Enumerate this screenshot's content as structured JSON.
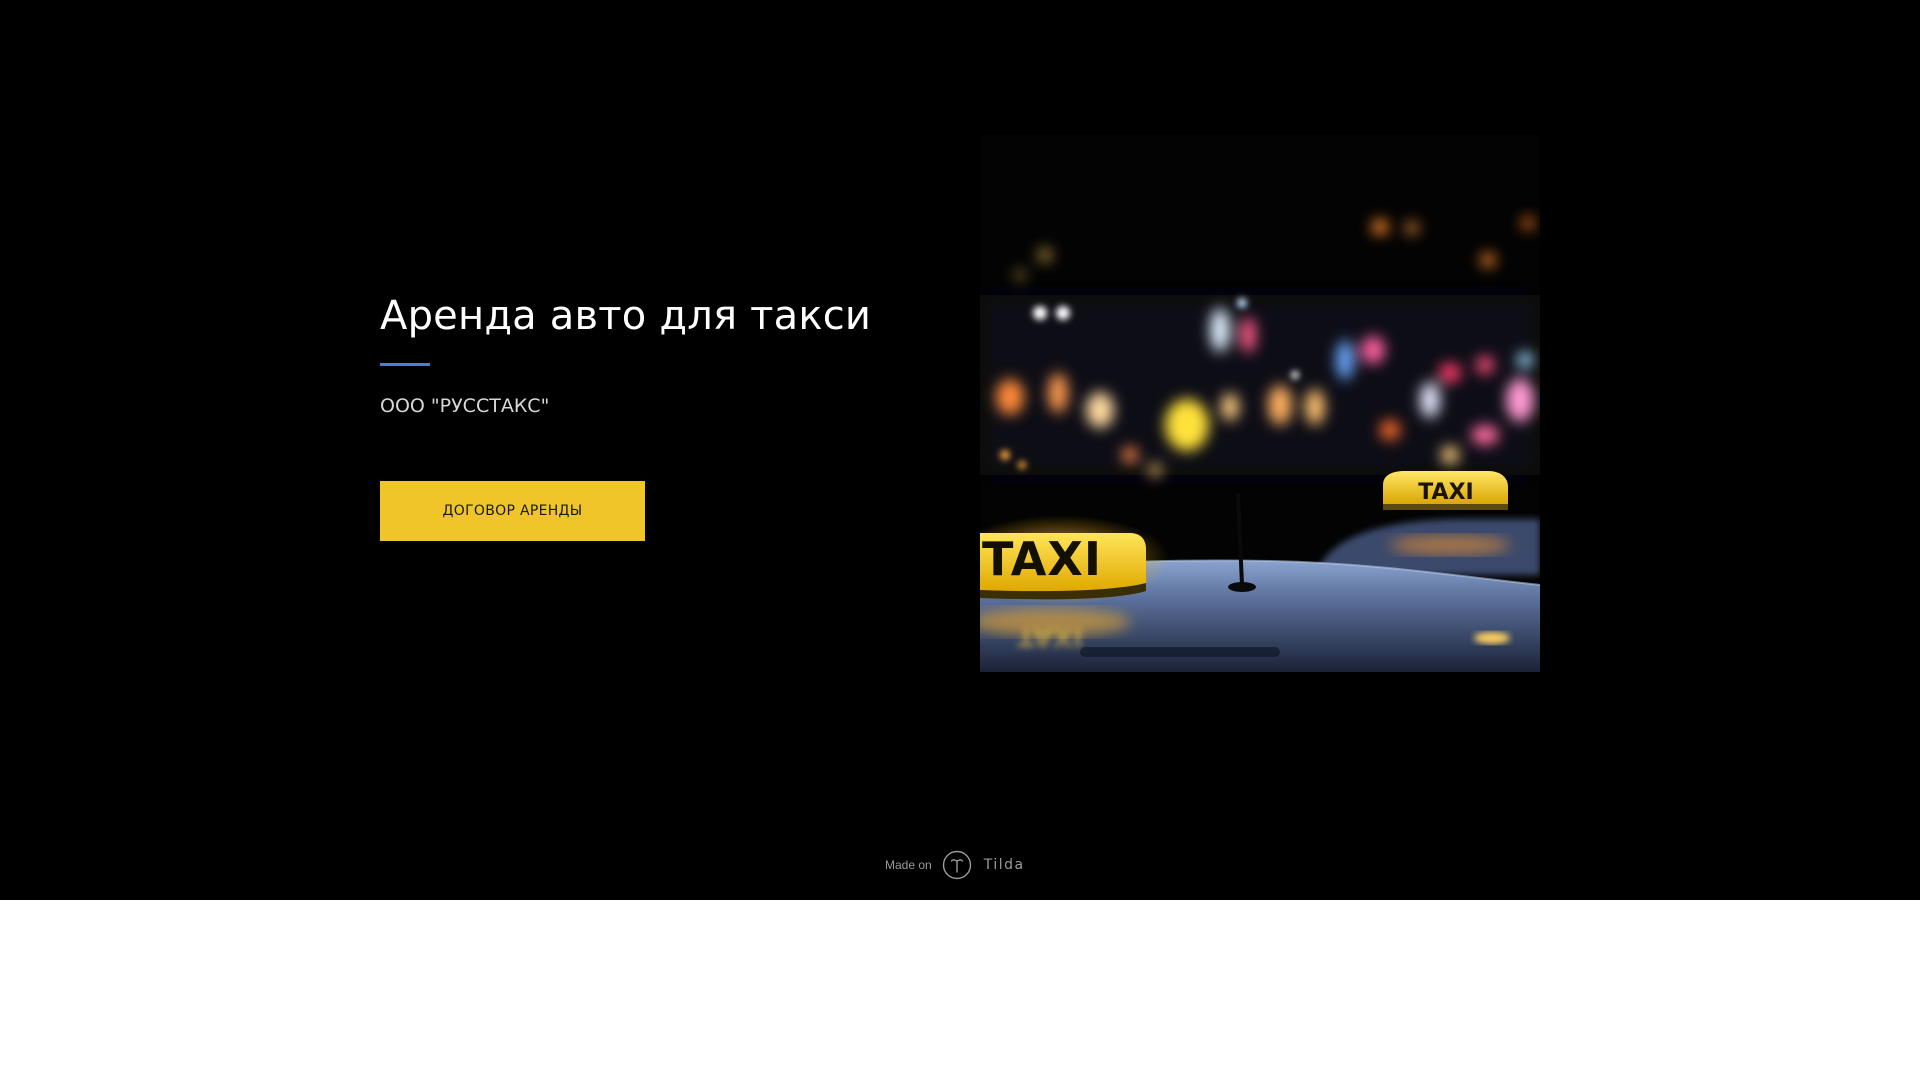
{
  "hero": {
    "title": "Аренда авто для такси",
    "subtitle": "ООО \"РУССТАКС\"",
    "cta_label": "ДОГОВОР АРЕНДЫ",
    "image": {
      "sign_front_text": "TAXI",
      "sign_back_text": "TAXI"
    }
  },
  "footer": {
    "made_on": "Made on",
    "brand": "Tilda"
  },
  "colors": {
    "hero_background": "#000000",
    "page_background": "#ffffff",
    "accent_line": "#4a7fd6",
    "cta_background": "#f0c52a",
    "title_text": "#ffffff"
  },
  "icons": {
    "footer_logo": "tilda-logo-icon"
  }
}
